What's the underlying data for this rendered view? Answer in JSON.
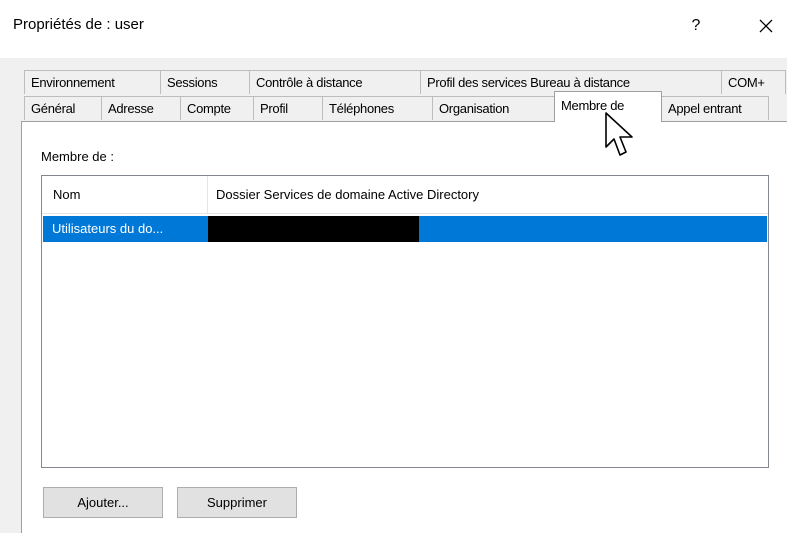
{
  "window": {
    "title": "Propriétés de : user",
    "help_label": "?",
    "close_icon": "close-icon"
  },
  "tabs": {
    "row1": [
      {
        "label": "Environnement"
      },
      {
        "label": "Sessions"
      },
      {
        "label": "Contrôle à distance"
      },
      {
        "label": "Profil des services Bureau à distance"
      },
      {
        "label": "COM+"
      }
    ],
    "row2": [
      {
        "label": "Général"
      },
      {
        "label": "Adresse"
      },
      {
        "label": "Compte"
      },
      {
        "label": "Profil"
      },
      {
        "label": "Téléphones"
      },
      {
        "label": "Organisation"
      },
      {
        "label": "Membre de",
        "active": true
      },
      {
        "label": "Appel entrant"
      }
    ]
  },
  "member_of": {
    "label": "Membre de :",
    "columns": [
      "Nom",
      "Dossier Services de domaine Active Directory"
    ],
    "rows": [
      {
        "name": "Utilisateurs du do...",
        "folder": "",
        "selected": true
      }
    ],
    "selection_color": "#0078d7"
  },
  "buttons": {
    "add": "Ajouter...",
    "remove": "Supprimer"
  }
}
